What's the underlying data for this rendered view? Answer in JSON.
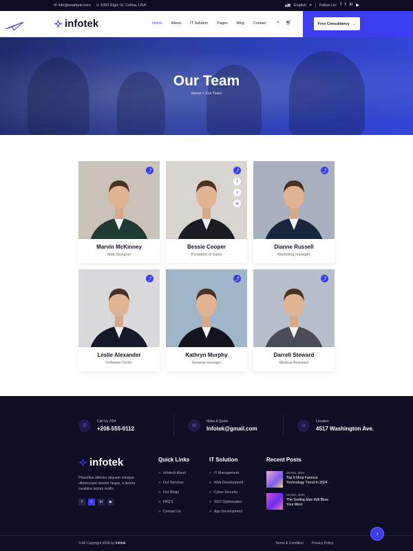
{
  "topbar": {
    "email": "info@example.com",
    "address": "6391 Elgin St. Celina, USA",
    "language": "English",
    "follow_label": "Follow Us:"
  },
  "brand": {
    "name": "infotek",
    "accent": "#3c3cf0"
  },
  "nav": {
    "items": [
      "Home",
      "About",
      "IT Solution",
      "Pages",
      "Blog",
      "Contact"
    ],
    "active": "Home",
    "cta": "Free Consultancy"
  },
  "hero": {
    "title": "Our Team",
    "breadcrumb_home": "Home",
    "breadcrumb_sep": "»",
    "breadcrumb_current": "Our Team"
  },
  "team": [
    {
      "name": "Marvin McKinney",
      "role": "Web Designer",
      "suit": "#1f3a32",
      "bg": "#c9c2b9"
    },
    {
      "name": "Bessie Cooper",
      "role": "President of Sales",
      "suit": "#1c1c24",
      "bg": "#d8d4cf"
    },
    {
      "name": "Dianne Russell",
      "role": "Marketing manager",
      "suit": "#1a2540",
      "bg": "#a8b0bd"
    },
    {
      "name": "Leslie Alexander",
      "role": "Software Tester",
      "suit": "#15192a",
      "bg": "#d9d9dd"
    },
    {
      "name": "Kathryn Murphy",
      "role": "General manager",
      "suit": "#14141c",
      "bg": "#9fb6c8"
    },
    {
      "name": "Darrell Steward",
      "role": "Medical Assistant",
      "suit": "#4a4d55",
      "bg": "#b6bfca"
    }
  ],
  "social_popup": [
    "f",
    "t",
    "in"
  ],
  "footer": {
    "contact": [
      {
        "label": "Call Us 7/24",
        "value": "+208-555-0112",
        "icon": "phone-icon"
      },
      {
        "label": "Make A Quote",
        "value": "Infotek@gmail.com",
        "icon": "mail-icon"
      },
      {
        "label": "Location",
        "value": "4517 Washington Ave.",
        "icon": "location-icon"
      }
    ],
    "description": "Phasellus ultricies aliquam volutpat ullamcorper laoreet neque, a lacinia curabitur lacinia mollis",
    "quick_links_title": "Quick Links",
    "quick_links": [
      "Infotech About",
      "Our Services",
      "Our Blogs",
      "FAQ'S",
      "Contact Us"
    ],
    "it_solution_title": "IT Solution",
    "it_solution": [
      "IT Management",
      "Web Development",
      "Cyber Security",
      "SEO Optimization",
      "App Development"
    ],
    "recent_posts_title": "Recent Posts",
    "posts": [
      {
        "date": "20 Feb, 2024",
        "title": "Top 5 Most Famous Technology Trend In 2024"
      },
      {
        "date": "15 Dec, 2024",
        "title": "The Surfing Man Will Blow Your Mind"
      }
    ],
    "copyright": "© All Copyright 2024 by",
    "copyright_brand": "Infotek",
    "terms": "Terms & Condition",
    "privacy": "Privacy Policy"
  }
}
